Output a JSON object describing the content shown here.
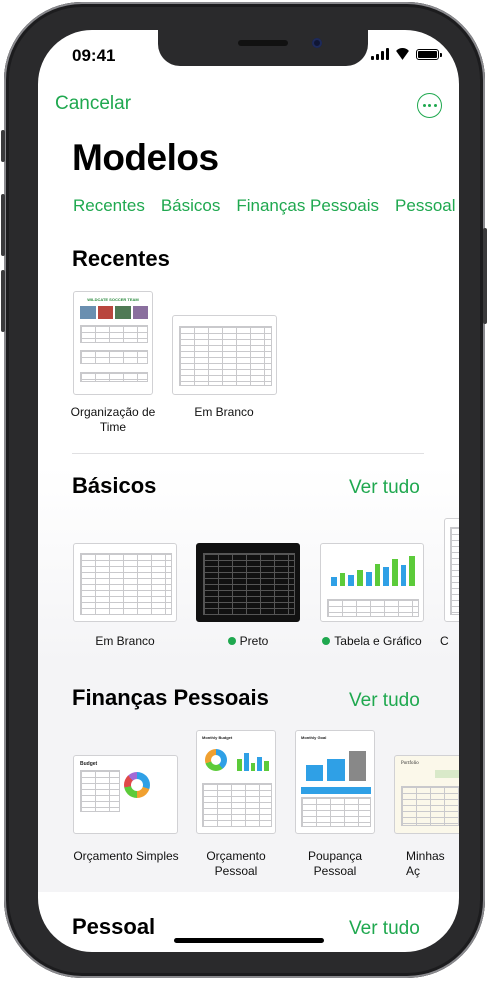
{
  "status": {
    "time": "09:41"
  },
  "nav": {
    "cancel": "Cancelar",
    "more_icon": "ellipsis-circle-icon"
  },
  "page_title": "Modelos",
  "tabs": [
    "Recentes",
    "Básicos",
    "Finanças Pessoais",
    "Pessoal"
  ],
  "recentes": {
    "title": "Recentes",
    "items": [
      {
        "label_1": "Organização de",
        "label_2": "Time",
        "thumb_title": "WILDCATE SOCCER TEAM"
      },
      {
        "label_1": "Em Branco"
      }
    ]
  },
  "basicos": {
    "title": "Básicos",
    "see_all": "Ver tudo",
    "items": [
      {
        "label": "Em Branco"
      },
      {
        "label": "Preto"
      },
      {
        "label": "Tabela e Gráfico"
      },
      {
        "label": "C"
      }
    ]
  },
  "financas": {
    "title": "Finanças Pessoais",
    "see_all": "Ver tudo",
    "items": [
      {
        "label_1": "Orçamento Simples",
        "thumb_title": "Budget"
      },
      {
        "label_1": "Orçamento",
        "label_2": "Pessoal",
        "thumb_title": "Monthly Budget"
      },
      {
        "label_1": "Poupança",
        "label_2": "Pessoal",
        "thumb_title": "Monthly Goal"
      },
      {
        "label_1": "Minhas Aç",
        "thumb_title": "Portfolio"
      }
    ]
  },
  "pessoal": {
    "title": "Pessoal",
    "see_all": "Ver tudo"
  },
  "colors": {
    "accent": "#1fa84f",
    "band": "#f4f4f6"
  }
}
